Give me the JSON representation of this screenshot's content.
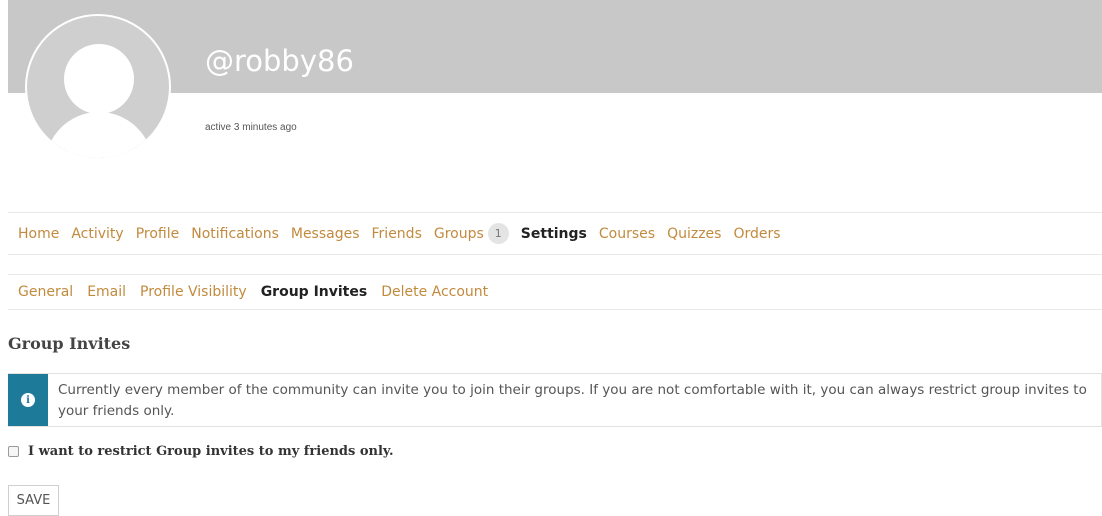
{
  "profile": {
    "username": "@robby86",
    "activity_status": "active 3 minutes ago"
  },
  "nav": {
    "items": [
      {
        "label": "Home",
        "current": false
      },
      {
        "label": "Activity",
        "current": false
      },
      {
        "label": "Profile",
        "current": false
      },
      {
        "label": "Notifications",
        "current": false
      },
      {
        "label": "Messages",
        "current": false
      },
      {
        "label": "Friends",
        "current": false
      },
      {
        "label": "Groups",
        "current": false,
        "badge": "1"
      },
      {
        "label": "Settings",
        "current": true
      },
      {
        "label": "Courses",
        "current": false
      },
      {
        "label": "Quizzes",
        "current": false
      },
      {
        "label": "Orders",
        "current": false
      }
    ]
  },
  "subnav": {
    "items": [
      {
        "label": "General",
        "current": false
      },
      {
        "label": "Email",
        "current": false
      },
      {
        "label": "Profile Visibility",
        "current": false
      },
      {
        "label": "Group Invites",
        "current": true
      },
      {
        "label": "Delete Account",
        "current": false
      }
    ]
  },
  "section": {
    "title": "Group Invites"
  },
  "notice": {
    "icon": "info-icon",
    "text": "Currently every member of the community can invite you to join their groups. If you are not comfortable with it, you can always restrict group invites to your friends only."
  },
  "form": {
    "checkbox_label": "I want to restrict Group invites to my friends only.",
    "checked": false,
    "save_label": "SAVE"
  },
  "colors": {
    "link": "#c28a3d",
    "cover": "#c8c8c8",
    "notice_icon_bg": "#1e7a99"
  }
}
